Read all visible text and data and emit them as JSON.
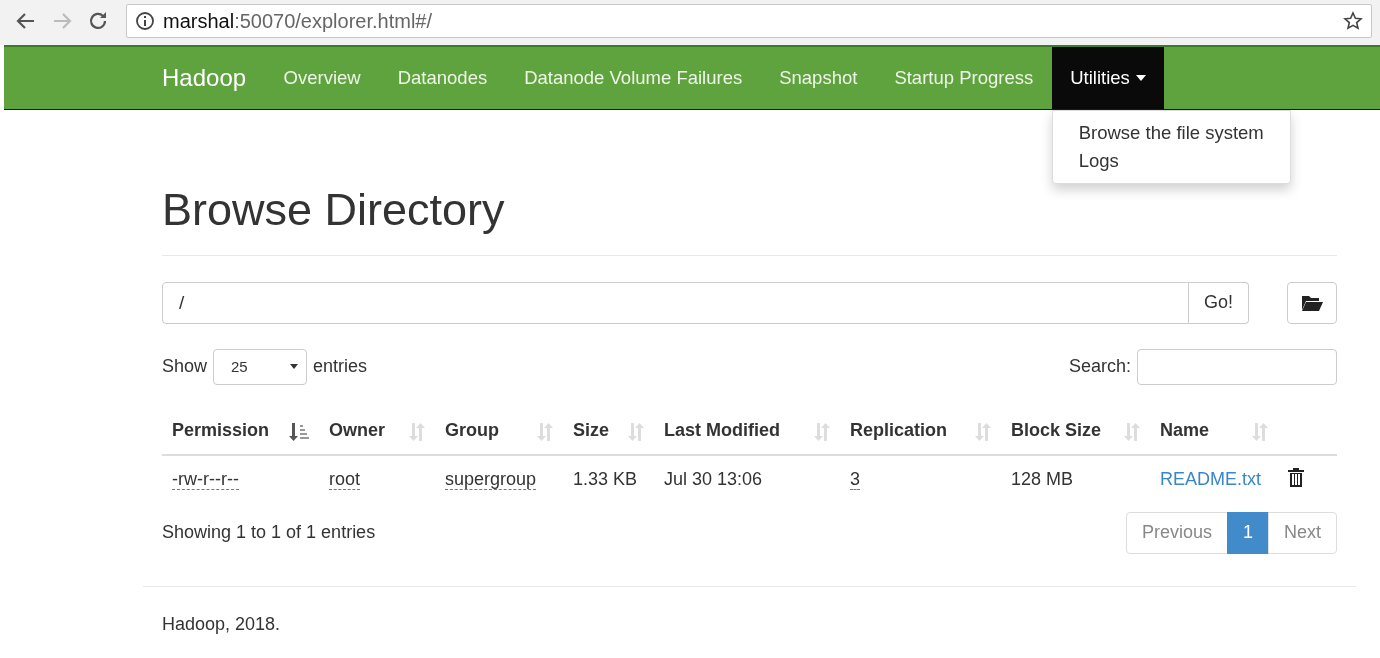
{
  "browser": {
    "url_host": "marshal",
    "url_rest": ":50070/explorer.html#/"
  },
  "navbar": {
    "brand": "Hadoop",
    "items": [
      {
        "label": "Overview",
        "selected": false
      },
      {
        "label": "Datanodes",
        "selected": false
      },
      {
        "label": "Datanode Volume Failures",
        "selected": false
      },
      {
        "label": "Snapshot",
        "selected": false
      },
      {
        "label": "Startup Progress",
        "selected": false
      },
      {
        "label": "Utilities",
        "selected": true,
        "expanded": true,
        "menu": [
          "Browse the file system",
          "Logs"
        ]
      }
    ]
  },
  "page": {
    "title": "Browse Directory",
    "path": {
      "value": "/",
      "button": "Go!"
    },
    "length": {
      "label_before": "Show",
      "value": "25",
      "label_after": "entries"
    },
    "search": {
      "label": "Search:"
    },
    "table": {
      "columns": [
        {
          "label": "Permission",
          "sorted": true
        },
        {
          "label": "Owner",
          "sorted": false
        },
        {
          "label": "Group",
          "sorted": false
        },
        {
          "label": "Size",
          "sorted": false
        },
        {
          "label": "Last Modified",
          "sorted": false
        },
        {
          "label": "Replication",
          "sorted": false
        },
        {
          "label": "Block Size",
          "sorted": false
        },
        {
          "label": "Name",
          "sorted": false
        }
      ],
      "rows": [
        {
          "cells": [
            {
              "text": "-rw-r--r--",
              "kind": "dotted"
            },
            {
              "text": "root",
              "kind": "dotted"
            },
            {
              "text": "supergroup",
              "kind": "dotted"
            },
            {
              "text": "1.33 KB",
              "kind": "plain"
            },
            {
              "text": "Jul 30 13:06",
              "kind": "plain"
            },
            {
              "text": "3",
              "kind": "dotted"
            },
            {
              "text": "128 MB",
              "kind": "plain"
            },
            {
              "text": "README.txt",
              "kind": "link"
            }
          ]
        }
      ]
    },
    "info": "Showing 1 to 1 of 1 entries",
    "pagination": [
      {
        "label": "Previous",
        "selected": false
      },
      {
        "label": "1",
        "selected": true
      },
      {
        "label": "Next",
        "selected": false
      }
    ],
    "footer": "Hadoop, 2018."
  }
}
